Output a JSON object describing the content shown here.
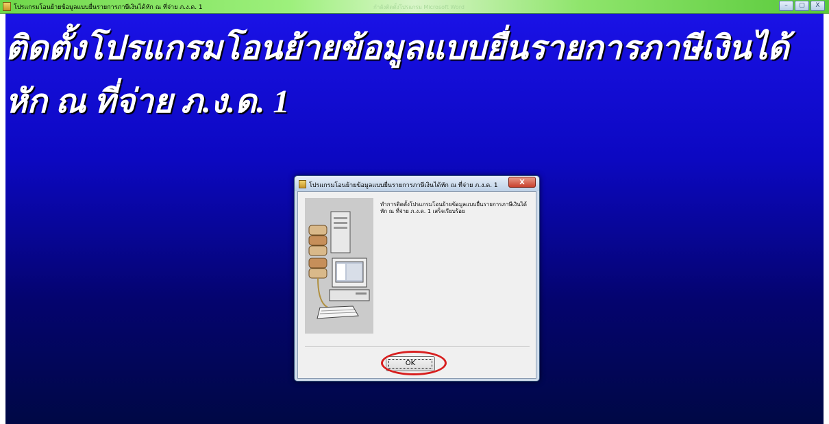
{
  "window": {
    "title": "โปรแกรมโอนย้ายข้อมูลแบบยื่นรายการภาษีเงินได้หัก ณ ที่จ่าย ภ.ง.ด. 1",
    "ghost_text": "กำลังติดตั้งโปรแกรม Microsoft Word",
    "minimize_label": "–",
    "maximize_label": "▢",
    "close_label": "X"
  },
  "headline": {
    "text": "ติดตั้งโปรแกรมโอนย้ายข้อมูลแบบยื่นรายการภาษีเงินได้หัก ณ ที่จ่าย ภ.ง.ด. 1"
  },
  "dialog": {
    "title": "โปรแกรมโอนย้ายข้อมูลแบบยื่นรายการภาษีเงินได้หัก ณ ที่จ่าย ภ.ง.ด. 1",
    "close_label": "X",
    "message": "ทำการติดตั้งโปรแกรมโอนย้ายข้อมูลแบบยื่นรายการภาษีเงินได้หัก ณ ที่จ่าย ภ.ง.ด. 1 เสร็จเรียบร้อย",
    "ok_label": "OK"
  },
  "colors": {
    "titlebar_green": "#6fd84a",
    "canvas_blue_top": "#1a12e6",
    "canvas_blue_bottom": "#000845",
    "highlight_red": "#d81f1f"
  },
  "icons": {
    "app": "installer-icon",
    "illustration": "server-computer-illustration"
  }
}
